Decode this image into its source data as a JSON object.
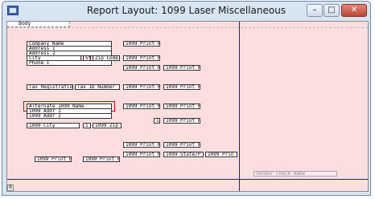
{
  "window": {
    "title": "Report Layout: 1099 Laser Miscellaneous",
    "minimize": "–",
    "maximize": "□",
    "close": "✕"
  },
  "canvas": {
    "section": "Body",
    "corner_label": "B"
  },
  "fields": {
    "company_name": "Company Name",
    "address_1": "Address 1",
    "address_2": "Address 2",
    "city": "City",
    "state": "St",
    "zip": "Zip Code",
    "phone": "Phone 1",
    "tax_registration": "Tax Registration",
    "tax_id": "Tax ID Number",
    "alternate_name": "Alternate 1099 Name",
    "addr_1": "1099 Addr 1",
    "addr_2": "1099 Addr 2",
    "city_1099": "1099 City",
    "state_1099": "1",
    "zip_1099": "1099 Zip",
    "print": "1099 Print F",
    "state_print": "1099 State/P",
    "print_short": "1099 Prin",
    "one": "1",
    "vendor_check_name": "Vendor Check Name"
  }
}
